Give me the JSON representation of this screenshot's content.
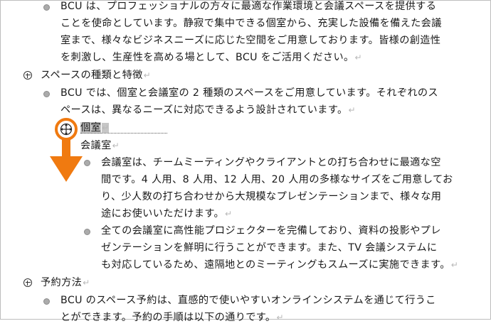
{
  "document": {
    "para1": [
      "BCU は、プロフェッショナルの方々に最適な作業環境と会議スペースを提供する",
      "ことを使命としています。静寂で集中できる個室から、充実した設備を備えた会議",
      "室まで、様々なビジネスニーズに応じた空間をご用意しております。皆様の創造性",
      "を刺激し、生産性を高める場として、BCU をご活用ください。"
    ],
    "heading_spaces": "スペースの種類と特徴",
    "para2": [
      "BCU では、個室と会議室の 2 種類のスペースをご用意しています。それぞれのス",
      "ペースは、異なるニーズに対応できるよう設計されています。"
    ],
    "heading_private_room": "個室",
    "heading_meeting_room": "会議室",
    "para3": [
      "会議室は、チームミーティングやクライアントとの打ち合わせに最適な空",
      "間です。4 人用、8 人用、12 人用、20 人用の多様なサイズをご用意してお",
      "り、少人数の打ち合わせから大規模なプレゼンテーションまで、様々な用",
      "途にお使いいただけます。"
    ],
    "para4": [
      "全ての会議室に高性能プロジェクターを完備しており、資料の投影やプレ",
      "ゼンテーションを鮮明に行うことができます。また、TV 会議システムに",
      "も対応しているため、遠隔地とのミーティングもスムーズに実施できます。"
    ],
    "heading_reservation": "予約方法",
    "para5": [
      "BCU のスペース予約は、直感的で使いやすいオンラインシステムを通じて行うこ",
      "とができます。予約の手順は以下の通りです。"
    ],
    "paragraph_mark": "↵"
  },
  "colors": {
    "accent": "#f07a10",
    "selection": "#c6c6c6"
  },
  "icons": [
    "move-handle-icon",
    "drag-down-arrow-icon",
    "expand-plus-icon"
  ]
}
